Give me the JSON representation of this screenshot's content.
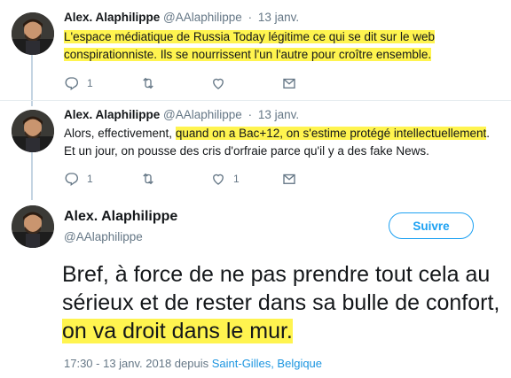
{
  "tweets": [
    {
      "name": "Alex. Alaphilippe",
      "handle": "@AAlaphilippe",
      "dot": "·",
      "date": "13 janv.",
      "text_pre": "",
      "text_highlight": "L'espace médiatique de Russia Today légitime ce qui se dit sur le web conspirationniste. Ils se nourrissent l'un l'autre pour croître ensemble.",
      "text_post": "",
      "reply_count": "1",
      "retweet_count": "",
      "like_count": ""
    },
    {
      "name": "Alex. Alaphilippe",
      "handle": "@AAlaphilippe",
      "dot": "·",
      "date": "13 janv.",
      "text_pre": "Alors, effectivement, ",
      "text_highlight": "quand on a Bac+12, on s'estime protégé intellectuellement",
      "text_post": ". Et un jour, on pousse des cris d'orfraie parce qu'il y a des fake News.",
      "reply_count": "1",
      "retweet_count": "",
      "like_count": "1"
    }
  ],
  "main": {
    "name": "Alex. Alaphilippe",
    "handle": "@AAlaphilippe",
    "follow_label": "Suivre",
    "text_pre": "Bref, à force de ne pas prendre tout cela au sérieux et de rester dans sa bulle de confort, ",
    "text_highlight": "on va droit dans le mur.",
    "timestamp": "17:30 - 13 janv. 2018 depuis",
    "location": "Saint-Gilles, Belgique"
  },
  "icons": {
    "reply": "reply-icon",
    "retweet": "retweet-icon",
    "like": "heart-icon",
    "dm": "envelope-icon"
  },
  "colors": {
    "highlight": "#fff44f",
    "accent": "#1da1f2",
    "muted": "#657786"
  }
}
